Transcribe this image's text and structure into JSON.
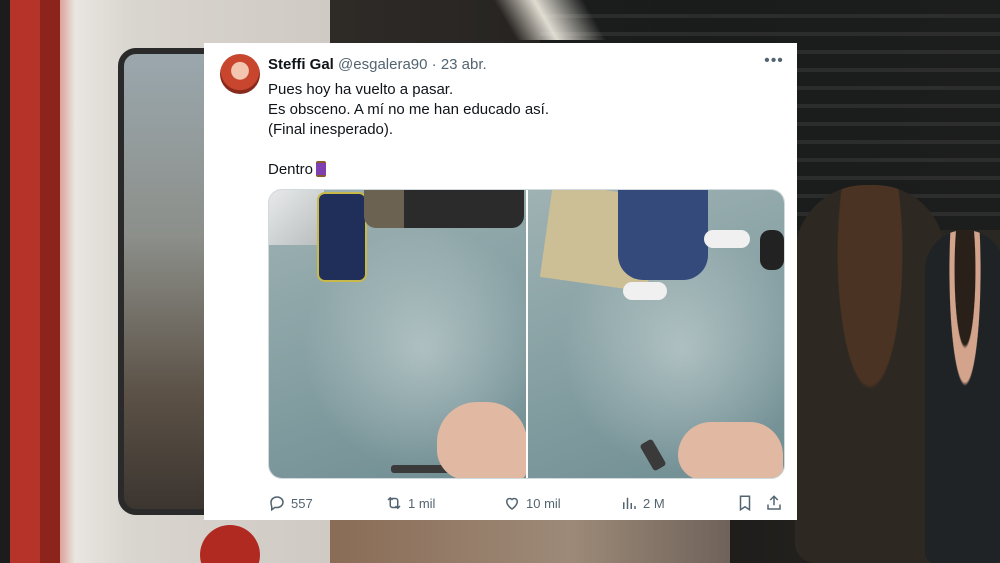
{
  "tweet": {
    "display_name": "Steffi Gal",
    "handle": "@esgalera90",
    "separator": "·",
    "date": "23 abr.",
    "more_icon": "more-horizontal-icon",
    "lines": [
      "Pues hoy ha vuelto a pasar.",
      "Es obsceno. A mí no me han educado así.",
      "(Final inesperado).",
      "",
      "Dentro"
    ],
    "thread_emoji": "spool-of-thread-icon",
    "media": [
      {
        "name": "photo-1"
      },
      {
        "name": "photo-2"
      }
    ],
    "actions": {
      "replies": "557",
      "retweets": "1 mil",
      "likes": "10 mil",
      "views": "2 M"
    }
  },
  "colors": {
    "card_bg": "#ffffff",
    "text_primary": "#0f1419",
    "text_secondary": "#536471",
    "border": "#cfd9de"
  }
}
